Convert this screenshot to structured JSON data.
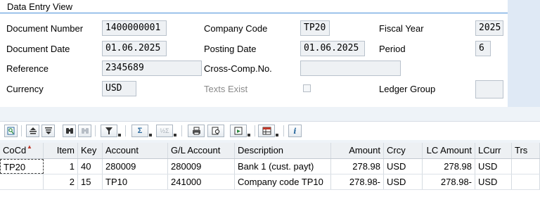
{
  "header": {
    "title": "Data Entry View",
    "fields": {
      "document_number": {
        "label": "Document Number",
        "value": "1400000001"
      },
      "company_code": {
        "label": "Company Code",
        "value": "TP20"
      },
      "fiscal_year": {
        "label": "Fiscal Year",
        "value": "2025"
      },
      "document_date": {
        "label": "Document Date",
        "value": "01.06.2025"
      },
      "posting_date": {
        "label": "Posting Date",
        "value": "01.06.2025"
      },
      "period": {
        "label": "Period",
        "value": "6"
      },
      "reference": {
        "label": "Reference",
        "value": "2345689"
      },
      "cross_comp": {
        "label": "Cross-Comp.No.",
        "value": ""
      },
      "currency": {
        "label": "Currency",
        "value": "USD"
      },
      "texts_exist": {
        "label": "Texts Exist",
        "checked": false
      },
      "ledger_group": {
        "label": "Ledger Group",
        "value": ""
      }
    }
  },
  "toolbar": {
    "icons": [
      "details-icon",
      "sort-ascending-icon",
      "sort-descending-icon",
      "find-icon",
      "find-next-icon",
      "filter-icon",
      "total-icon",
      "subtotal-icon",
      "print-icon",
      "print-preview-icon",
      "export-icon",
      "layout-icon",
      "info-icon"
    ],
    "sigma": "Σ",
    "subtotal": "½Σ",
    "info": "i"
  },
  "grid": {
    "columns": [
      "CoCd",
      "Item",
      "Key",
      "Account",
      "G/L Account",
      "Description",
      "Amount",
      "Crcy",
      "LC Amount",
      "LCurr",
      "Trs"
    ],
    "rows": [
      {
        "cocd": "TP20",
        "item": "1",
        "key": "40",
        "account": "280009",
        "gl_account": "280009",
        "description": "Bank 1 (cust. payt)",
        "amount": "278.98",
        "crcy": "USD",
        "lc_amount": "278.98",
        "lcurr": "USD",
        "trs": ""
      },
      {
        "cocd": "",
        "item": "2",
        "key": "15",
        "account": "TP10",
        "gl_account": "241000",
        "description": "Company code TP10",
        "amount": "278.98-",
        "crcy": "USD",
        "lc_amount": "278.98-",
        "lcurr": "USD",
        "trs": ""
      }
    ]
  },
  "colors": {
    "accent_line": "#4a90d9",
    "panel_bg": "#ffffff",
    "page_bg": "#eef3f8"
  }
}
